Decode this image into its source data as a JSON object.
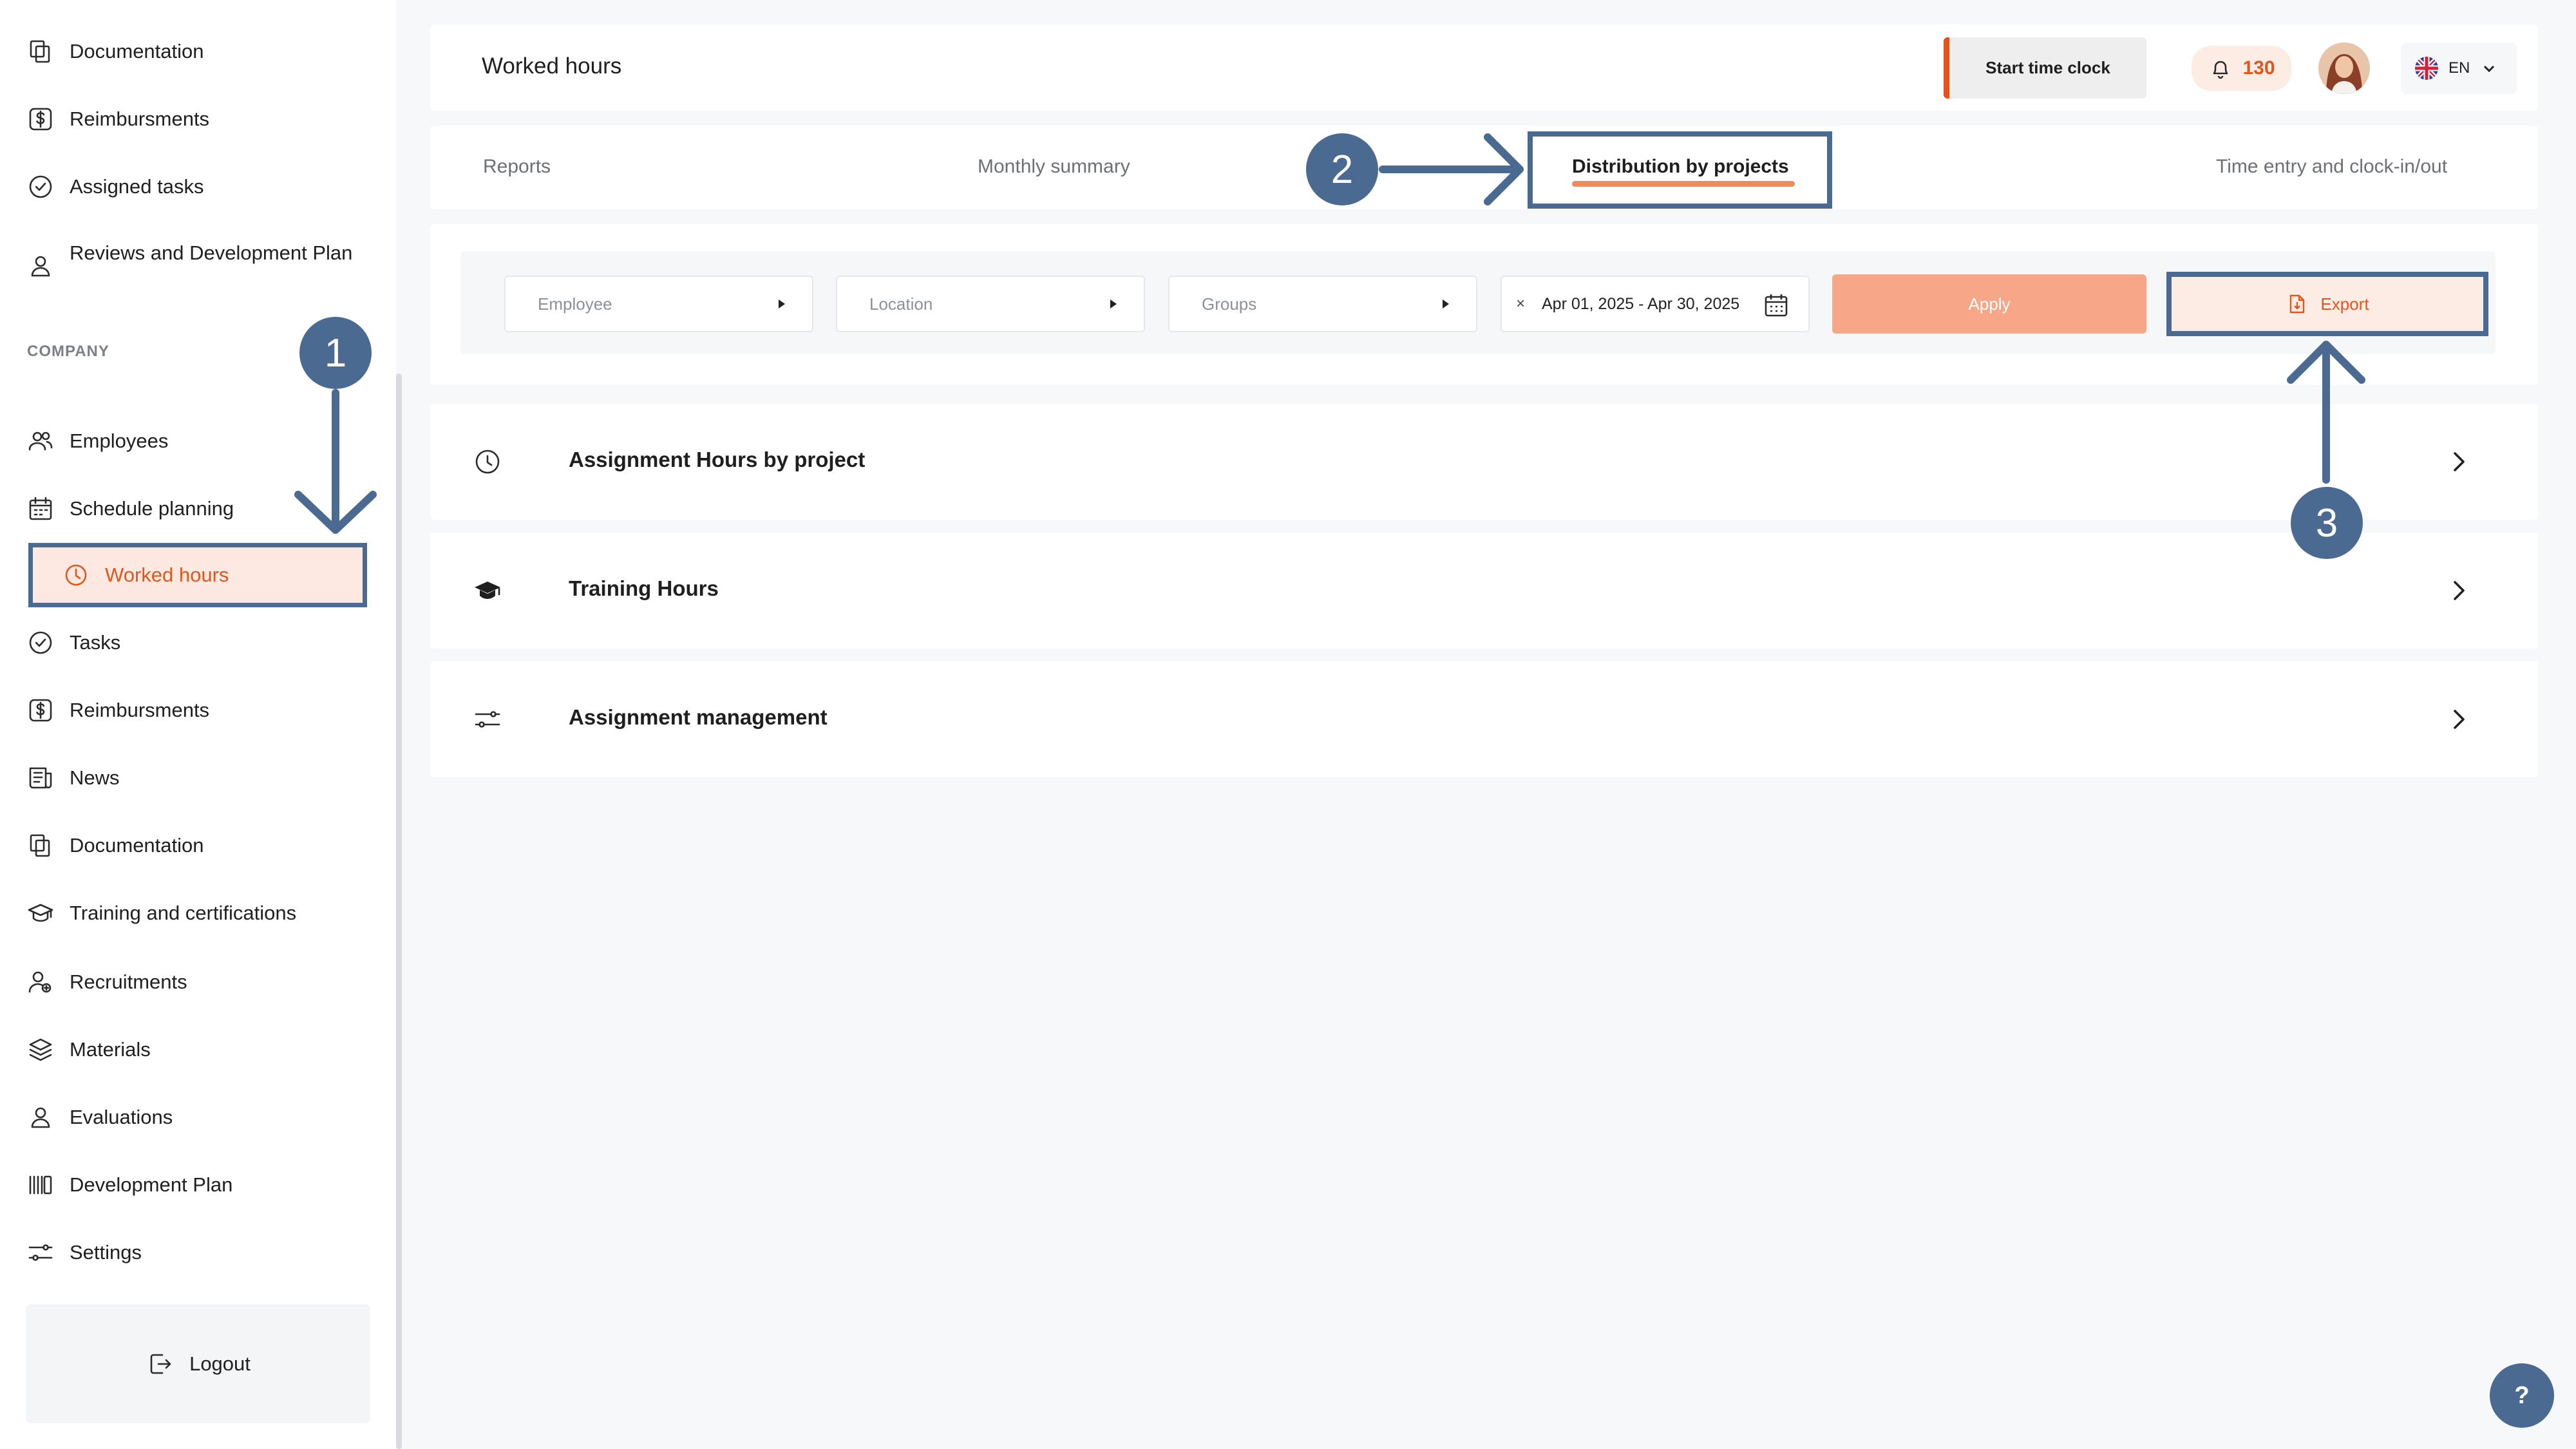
{
  "sidebar": {
    "items_top": [
      {
        "label": "Documentation",
        "icon": "documents-icon"
      },
      {
        "label": "Reimbursments",
        "icon": "dollar-icon"
      },
      {
        "label": "Assigned tasks",
        "icon": "check-circle-icon"
      },
      {
        "label": "Reviews and Development Plan",
        "icon": "person-icon"
      }
    ],
    "section_title": "COMPANY",
    "items_company": [
      {
        "label": "Employees",
        "icon": "users-icon"
      },
      {
        "label": "Schedule planning",
        "icon": "calendar-icon"
      },
      {
        "label": "Worked hours",
        "icon": "clock-icon",
        "active": true
      },
      {
        "label": "Tasks",
        "icon": "check-circle-icon"
      },
      {
        "label": "Reimbursments",
        "icon": "dollar-icon"
      },
      {
        "label": "News",
        "icon": "news-icon"
      },
      {
        "label": "Documentation",
        "icon": "documents-icon"
      },
      {
        "label": "Training and certifications",
        "icon": "graduation-cap-icon"
      },
      {
        "label": "Recruitments",
        "icon": "recruit-icon"
      },
      {
        "label": "Materials",
        "icon": "layers-icon"
      },
      {
        "label": "Evaluations",
        "icon": "person-icon"
      },
      {
        "label": "Development Plan",
        "icon": "bars-icon"
      },
      {
        "label": "Settings",
        "icon": "sliders-icon"
      }
    ],
    "logout_label": "Logout"
  },
  "header": {
    "title": "Worked hours",
    "start_clock_label": "Start time clock",
    "points": "130",
    "language": "EN"
  },
  "tabs": [
    {
      "label": "Reports"
    },
    {
      "label": "Monthly summary"
    },
    {
      "label": "Distribution by projects",
      "active": true
    },
    {
      "label": "Time entry and clock-in/out"
    }
  ],
  "filters": {
    "employee_placeholder": "Employee",
    "location_placeholder": "Location",
    "groups_placeholder": "Groups",
    "date_range": "Apr 01, 2025 - Apr 30, 2025",
    "clear_symbol": "×",
    "apply_label": "Apply",
    "export_label": "Export"
  },
  "reports": [
    {
      "label": "Assignment Hours by project",
      "icon": "clock-icon"
    },
    {
      "label": "Training Hours",
      "icon": "graduation-cap-icon"
    },
    {
      "label": "Assignment management",
      "icon": "sliders-icon"
    }
  ],
  "annotations": {
    "step1": "1",
    "step2": "2",
    "step3": "3",
    "color": "#4a6a91"
  },
  "help_label": "?",
  "colors": {
    "accent": "#e0571e",
    "accent_light": "#fde9e2",
    "apply": "#f7a688",
    "annotation": "#4a6a91"
  }
}
